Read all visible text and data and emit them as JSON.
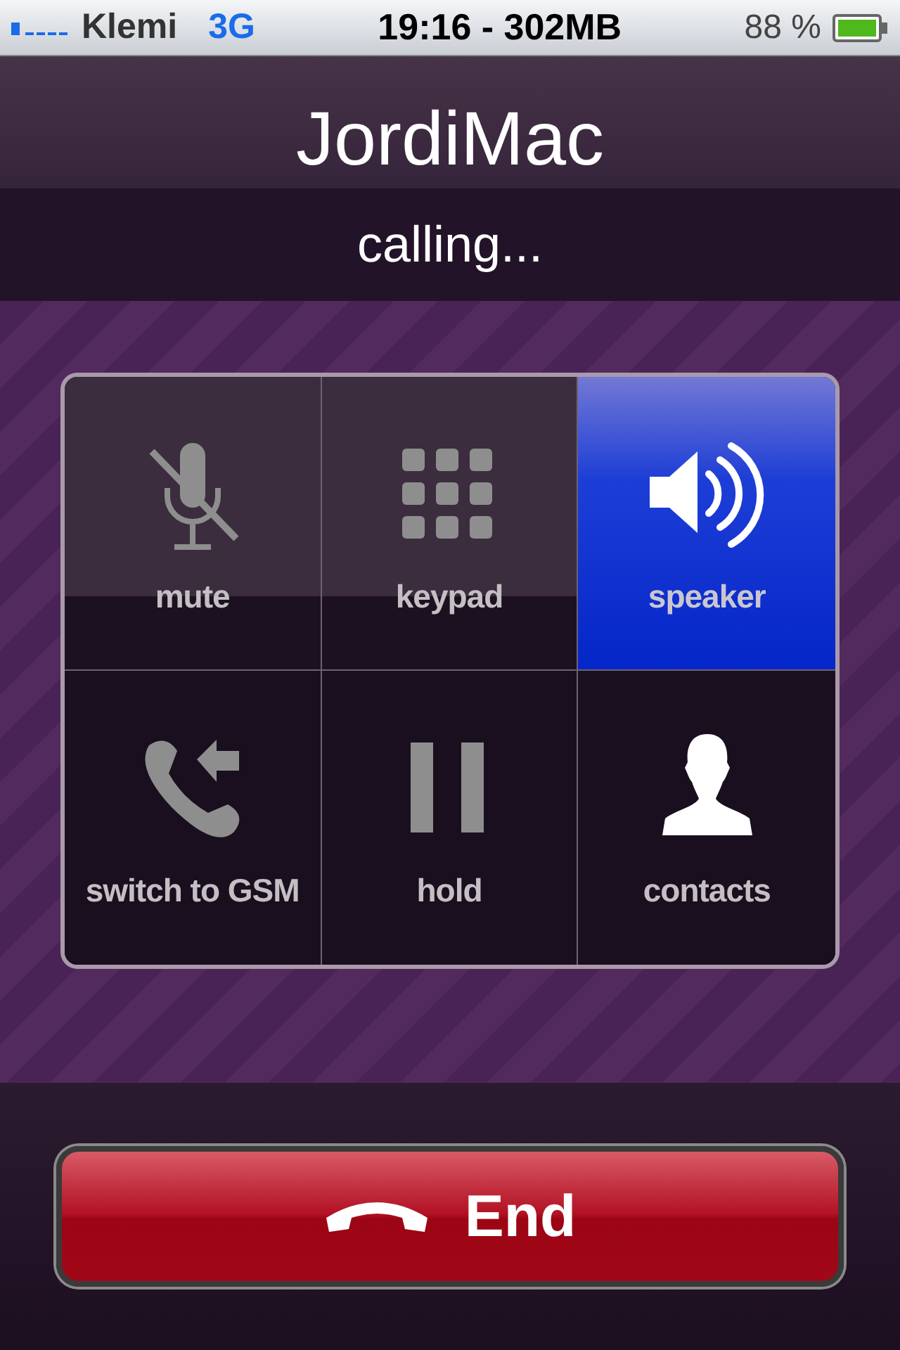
{
  "status_bar": {
    "carrier": "Klemi",
    "network": "3G",
    "center": "19:16 - 302MB",
    "battery": "88 %"
  },
  "caller": {
    "name": "JordiMac",
    "status": "calling..."
  },
  "buttons": [
    {
      "kind": "mute",
      "label": "mute",
      "selected": false,
      "disabled": true
    },
    {
      "kind": "keypad",
      "label": "keypad",
      "selected": false,
      "disabled": true
    },
    {
      "kind": "speaker",
      "label": "speaker",
      "selected": true,
      "disabled": false
    },
    {
      "kind": "switch",
      "label": "switch to GSM",
      "selected": false,
      "disabled": true
    },
    {
      "kind": "hold",
      "label": "hold",
      "selected": false,
      "disabled": true
    },
    {
      "kind": "contacts",
      "label": "contacts",
      "selected": false,
      "disabled": false
    }
  ],
  "end_button": {
    "label": "End"
  }
}
